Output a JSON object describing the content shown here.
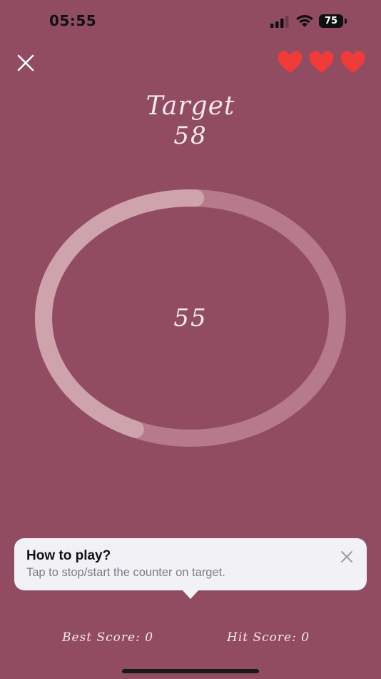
{
  "status_bar": {
    "time": "05:55",
    "battery_level": "75",
    "icons": [
      "cellular-signal-icon",
      "wifi-icon",
      "battery-icon"
    ]
  },
  "header": {
    "close_icon": "close-icon",
    "lives": 3,
    "heart_icon": "heart-icon",
    "heart_color": "#f03b3b"
  },
  "game": {
    "target_label": "Target",
    "target_value": "58",
    "counter_value": "55",
    "ring_track_color": "#b77a8a",
    "ring_progress_color": "#cfa3ab"
  },
  "tooltip": {
    "title": "How to play?",
    "body": "Tap to stop/start the counter on target.",
    "close_icon": "close-icon"
  },
  "scores": {
    "best_label": "Best Score: ",
    "best_value": "0",
    "hit_label": "Hit Score: ",
    "hit_value": "0"
  },
  "colors": {
    "background": "#914c62",
    "text": "#f6e8ec",
    "tooltip_bg": "#f2f1f6"
  }
}
